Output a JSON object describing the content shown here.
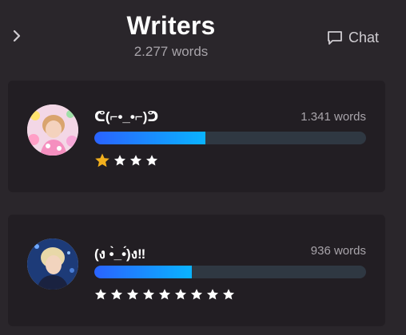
{
  "header": {
    "title": "Writers",
    "subtitle": "2.277 words",
    "chat_label": "Chat"
  },
  "writers": [
    {
      "name": "ᕦ(⌐•_•⌐)ᕤ",
      "words": "1.341 words",
      "progress": 0.41,
      "stars_gold": 1,
      "stars_white": 3
    },
    {
      "name": "(ง •̀_•́)ง‼",
      "words": "936 words",
      "progress": 0.36,
      "stars_gold": 0,
      "stars_white": 9
    }
  ],
  "colors": {
    "background": "#2a262b",
    "card": "#221e23",
    "bar_start": "#2a63ff",
    "bar_end": "#0ab3ff",
    "bar_track": "#2f3842",
    "star_gold": "#f2b01e",
    "star_white": "#ffffff"
  },
  "icons": {
    "back": "chevron-right-icon",
    "chat": "chat-bubble-icon",
    "star": "star-icon"
  }
}
